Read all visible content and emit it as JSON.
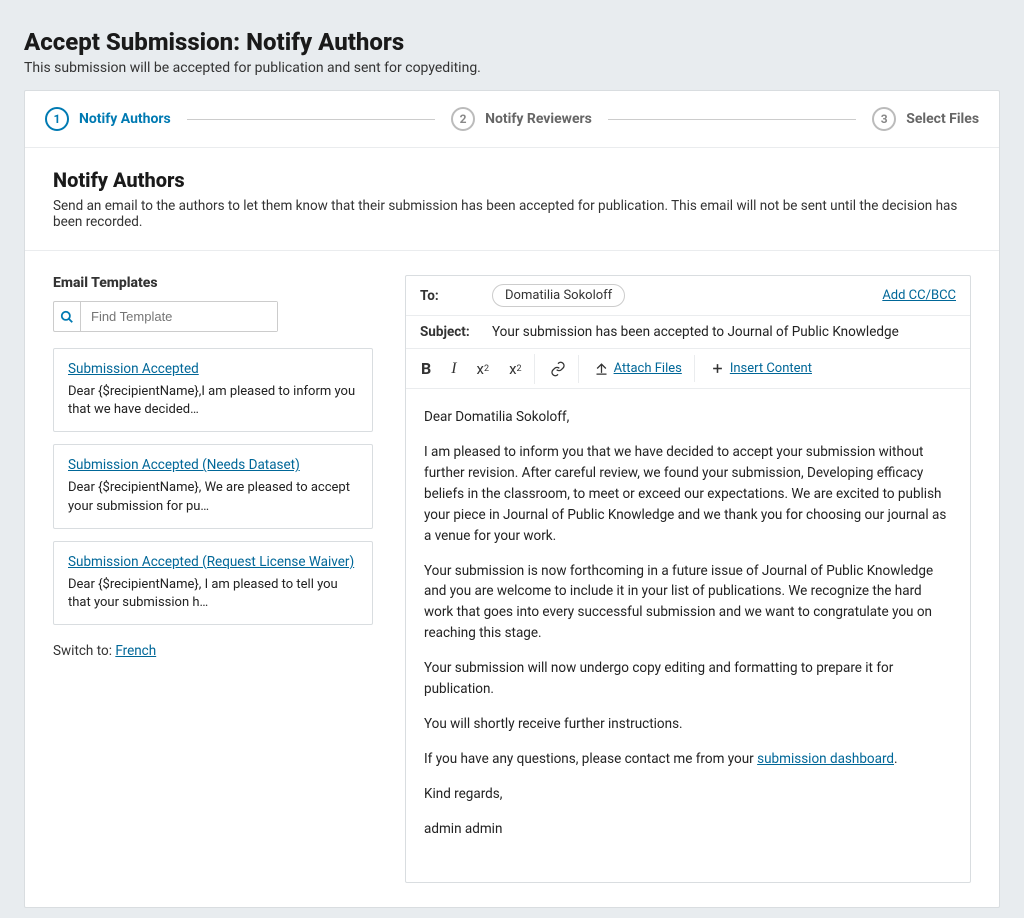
{
  "header": {
    "title": "Accept Submission: Notify Authors",
    "subtitle": "This submission will be accepted for publication and sent for copyediting."
  },
  "steps": [
    {
      "num": "1",
      "label": "Notify Authors",
      "active": true
    },
    {
      "num": "2",
      "label": "Notify Reviewers",
      "active": false
    },
    {
      "num": "3",
      "label": "Select Files",
      "active": false
    }
  ],
  "section": {
    "heading": "Notify Authors",
    "desc": "Send an email to the authors to let them know that their submission has been accepted for publication. This email will not be sent until the decision has been recorded."
  },
  "templates": {
    "heading": "Email Templates",
    "search_placeholder": "Find Template",
    "items": [
      {
        "title": "Submission Accepted",
        "preview": "Dear {$recipientName},I am pleased to inform you that we have decided…"
      },
      {
        "title": "Submission Accepted (Needs Dataset)",
        "preview": "Dear {$recipientName}, We are pleased to accept your submission for pu…"
      },
      {
        "title": "Submission Accepted (Request License Waiver)",
        "preview": "Dear {$recipientName}, I am pleased to tell you that your submission h…"
      }
    ],
    "switch_label": "Switch to:",
    "switch_lang": "French"
  },
  "email": {
    "to_label": "To:",
    "to_recipient": "Domatilia Sokoloff",
    "add_cc": "Add CC/BCC",
    "subject_label": "Subject:",
    "subject_value": "Your submission has been accepted to Journal of Public Knowledge",
    "toolbar": {
      "attach": "Attach Files",
      "insert": "Insert Content"
    },
    "body": {
      "p1": "Dear Domatilia Sokoloff,",
      "p2": "I am pleased to inform you that we have decided to accept your submission without further revision. After careful review, we found your submission, Developing efficacy beliefs in the classroom, to meet or exceed our expectations. We are excited to publish your piece in Journal of Public Knowledge and we thank you for choosing our journal as a venue for your work.",
      "p3": "Your submission is now forthcoming in a future issue of Journal of Public Knowledge and you are welcome to include it in your list of publications. We recognize the hard work that goes into every successful submission and we want to congratulate you on reaching this stage.",
      "p4": "Your submission will now undergo copy editing and formatting to prepare it for publication.",
      "p5": "You will shortly receive further instructions.",
      "p6_pre": "If you have any questions, please contact me from your ",
      "p6_link": "submission dashboard",
      "p6_post": ".",
      "p7": "Kind regards,",
      "p8": "admin admin"
    }
  }
}
